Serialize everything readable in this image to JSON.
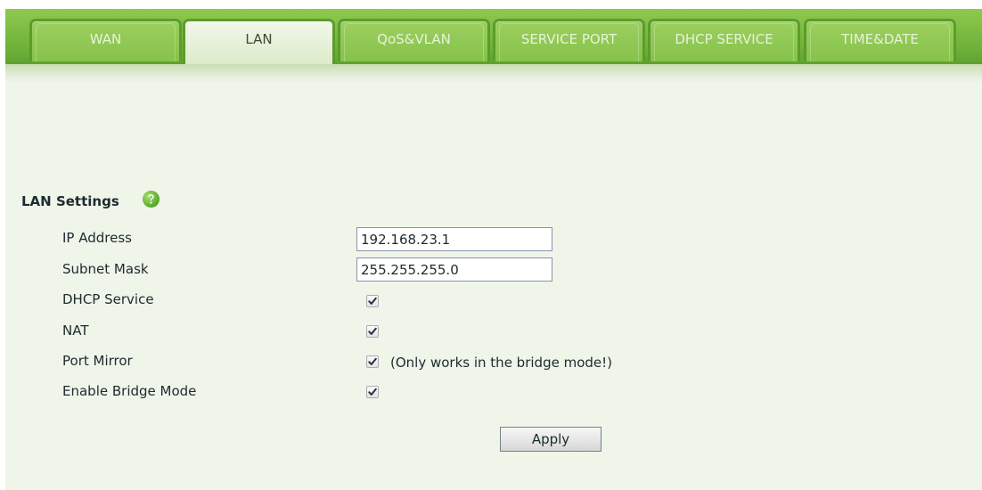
{
  "tabs": [
    {
      "label": "WAN",
      "active": false
    },
    {
      "label": "LAN",
      "active": true
    },
    {
      "label": "QoS&VLAN",
      "active": false
    },
    {
      "label": "SERVICE PORT",
      "active": false
    },
    {
      "label": "DHCP SERVICE",
      "active": false
    },
    {
      "label": "TIME&DATE",
      "active": false
    }
  ],
  "lan_settings": {
    "title": "LAN Settings",
    "help_icon": "help-icon",
    "ip_address": {
      "label": "IP Address",
      "value": "192.168.23.1"
    },
    "subnet_mask": {
      "label": "Subnet Mask",
      "value": "255.255.255.0"
    },
    "dhcp_service": {
      "label": "DHCP Service",
      "checked": true
    },
    "nat": {
      "label": "NAT",
      "checked": true
    },
    "port_mirror": {
      "label": "Port Mirror",
      "checked": true,
      "note": "(Only works in the bridge mode!)"
    },
    "enable_bridge_mode": {
      "label": "Enable Bridge Mode",
      "checked": true
    }
  },
  "apply_label": "Apply",
  "colors": {
    "tab_bar": "#6fb23a",
    "tab_active": "#e6f0da",
    "background": "#f0f5ea",
    "help_icon": "#5fb02e"
  }
}
